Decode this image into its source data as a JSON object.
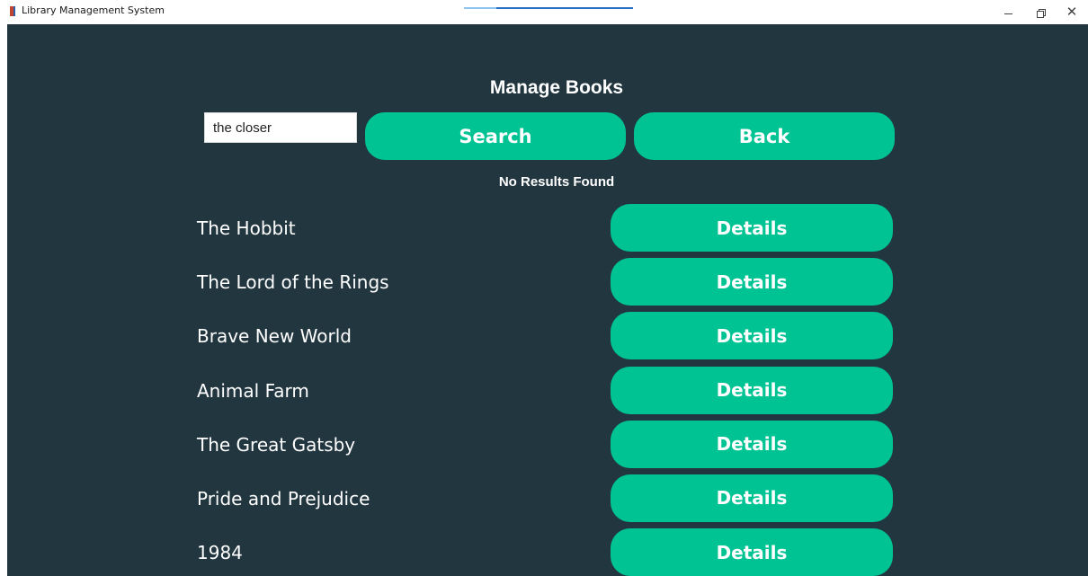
{
  "window": {
    "title": "Library Management System",
    "controls": {
      "minimize_icon": "minimize-icon",
      "maximize_icon": "restore-icon",
      "close_icon": "close-icon",
      "close_glyph": "✕"
    }
  },
  "colors": {
    "background": "#223640",
    "accent": "#00c394",
    "text": "#ffffff"
  },
  "header": {
    "title": "Manage Books"
  },
  "search": {
    "value": "the closer",
    "button_label": "Search"
  },
  "back_button_label": "Back",
  "status": {
    "message": "No Results Found"
  },
  "books": [
    {
      "title": "The Hobbit",
      "button_label": "Details"
    },
    {
      "title": "The Lord of the Rings",
      "button_label": "Details"
    },
    {
      "title": "Brave New World",
      "button_label": "Details"
    },
    {
      "title": "Animal Farm",
      "button_label": "Details"
    },
    {
      "title": "The Great Gatsby",
      "button_label": "Details"
    },
    {
      "title": "Pride and Prejudice",
      "button_label": "Details"
    },
    {
      "title": "1984",
      "button_label": "Details"
    }
  ]
}
